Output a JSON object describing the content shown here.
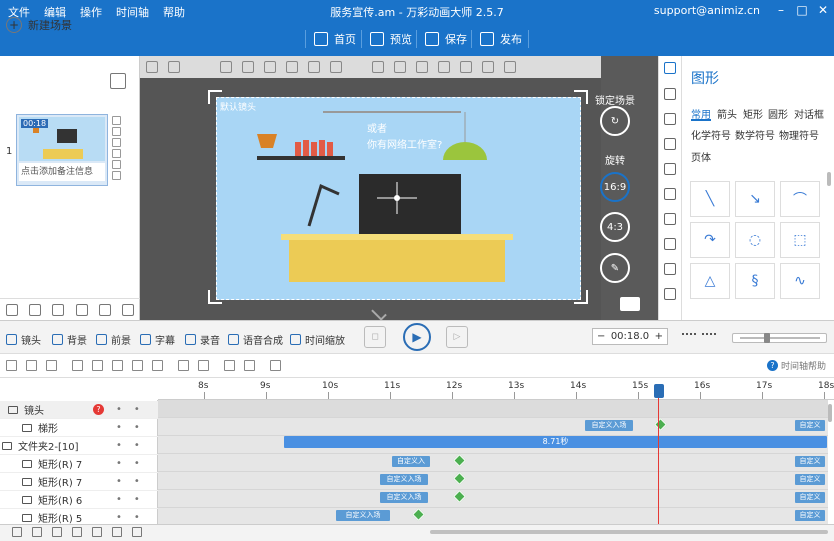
{
  "window": {
    "title": "服务宣传.am - 万彩动画大师 2.5.7",
    "support": "support@animiz.cn",
    "menu": [
      "文件",
      "编辑",
      "操作",
      "时间轴",
      "帮助"
    ]
  },
  "toolbar": {
    "home": "首页",
    "preview": "预览",
    "save": "保存",
    "publish": "发布"
  },
  "scenes": {
    "new_scene": "新建场景",
    "number": "1",
    "thumb_time": "00:18",
    "note": "点击添加备注信息"
  },
  "canvas": {
    "camera_label": "默认镜头",
    "text_line1": "或者",
    "text_line2": "你有网络工作室?"
  },
  "canvas_side": {
    "lock": "锁定场景",
    "rotate": "旋转",
    "ratio1": "16:9",
    "ratio2": "4:3"
  },
  "shape_panel": {
    "title": "图形",
    "categories": [
      "常用",
      "箭头",
      "矩形",
      "圆形",
      "对话框",
      "化学符号",
      "数学符号",
      "物理符号",
      "页体"
    ]
  },
  "timeline_toolbar": {
    "items": [
      "镜头",
      "背景",
      "前景",
      "字幕",
      "录音",
      "语音合成",
      "时间缩放"
    ],
    "time": "00:18.0",
    "help": "时间轴帮助"
  },
  "ruler": {
    "ticks": [
      "8s",
      "9s",
      "10s",
      "11s",
      "12s",
      "13s",
      "14s",
      "15s",
      "16s",
      "17s",
      "18s"
    ]
  },
  "tracks": [
    {
      "name": "镜头",
      "tags": []
    },
    {
      "name": "梯形",
      "tags": [
        "自定义入场",
        "自定义"
      ]
    },
    {
      "name": "文件夹2-[10]",
      "bar": "8.71秒"
    },
    {
      "name": "矩形(R) 7",
      "tags": [
        "自定义入",
        "自定义"
      ]
    },
    {
      "name": "矩形(R) 7",
      "tags": [
        "自定义入场",
        "自定义"
      ]
    },
    {
      "name": "矩形(R) 6",
      "tags": [
        "自定义入场",
        "自定义"
      ]
    },
    {
      "name": "矩形(R) 5",
      "tags": [
        "自定义入场",
        "自定义"
      ]
    }
  ],
  "colors": {
    "accent": "#1a73c9",
    "stage": "#a9d6f5",
    "track_tag": "#5b9bd5",
    "keyframe": "#4caf50",
    "playhead_line": "#e53935"
  }
}
